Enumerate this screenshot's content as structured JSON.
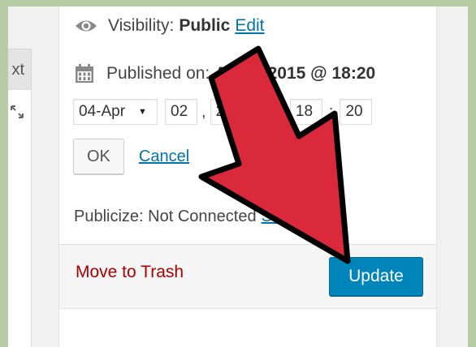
{
  "editor": {
    "tab_fragment": "xt"
  },
  "publish": {
    "visibility_label": "Visibility:",
    "visibility_value": "Public",
    "visibility_edit": "Edit",
    "published_label": "Published on:",
    "published_value": "Apr 2, 2015 @ 18:20",
    "month_selected": "04-Apr",
    "day": "02",
    "year": "2015",
    "hour": "18",
    "minute": "20",
    "comma": ",",
    "at": "@",
    "colon": ":",
    "ok_label": "OK",
    "cancel_label": "Cancel",
    "publicize_text": "Publicize: Not Connected",
    "publicize_link": "Show",
    "trash_label": "Move to Trash",
    "update_label": "Update"
  },
  "colors": {
    "background": "#b7cca4",
    "link": "#0073aa",
    "trash": "#aa0000",
    "update_button": "#0085ba",
    "arrow_fill": "#d9293a",
    "arrow_outline": "#000000"
  },
  "icons": [
    "eye-icon",
    "calendar-icon",
    "expand-icon",
    "dropdown-caret-icon"
  ],
  "overlay": "red-arrow-pointing-at-update"
}
